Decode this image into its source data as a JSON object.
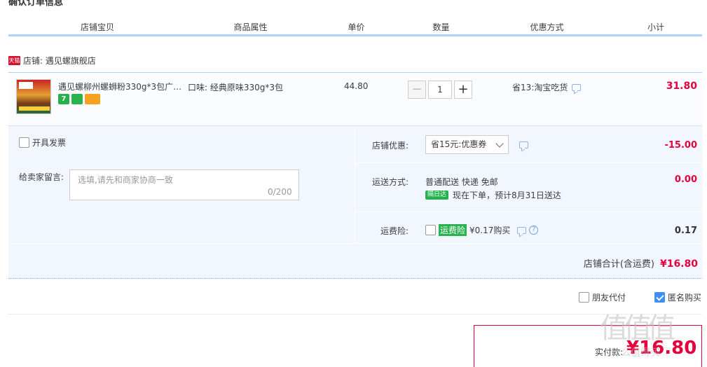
{
  "section_title": "确认订单信息",
  "columns": [
    {
      "label": "店铺宝贝",
      "w": 256
    },
    {
      "label": "商品属性",
      "w": 181
    },
    {
      "label": "单价",
      "w": 121
    },
    {
      "label": "数量",
      "w": 121
    },
    {
      "label": "优惠方式",
      "w": 181
    },
    {
      "label": "小计",
      "w": 130
    }
  ],
  "shop": {
    "badge": "天猫",
    "name": "店铺: 遇见螺旗舰店"
  },
  "item": {
    "title": "遇见螺柳州螺蛳粉330g*3包广…",
    "badge_1": "7",
    "attribute": "口味: 经典原味330g*3包",
    "price": "44.80",
    "quantity": "1",
    "minus": "−",
    "plus": "+",
    "promo": "省13:淘宝吃货",
    "subtotal": "31.80"
  },
  "invoice_label": "开具发票",
  "message": {
    "label": "给卖家留言:",
    "placeholder": "选填,请先和商家协商一致",
    "count": "0/200"
  },
  "shop_discount": {
    "label": "店铺优惠:",
    "selected": "省15元:优惠券",
    "value": "-15.00"
  },
  "shipping": {
    "label": "运送方式:",
    "method": "普通配送 快递 免邮",
    "tag": "隔日达",
    "eta": "现在下单，预计8月31日送达",
    "value": "0.00"
  },
  "insurance": {
    "label": "运费险:",
    "tag": "运费险",
    "price": "¥0.17购买",
    "help": "?",
    "value": "0.17"
  },
  "shop_total": {
    "label": "店铺合计(含运费)",
    "value": "¥16.80"
  },
  "friend_pay_label": "朋友代付",
  "anon_label": "匿名购买",
  "pay": {
    "label": "实付款:",
    "value": "¥16.80"
  },
  "watermark": {
    "main": "值值值",
    "sub": "什么值得买"
  }
}
